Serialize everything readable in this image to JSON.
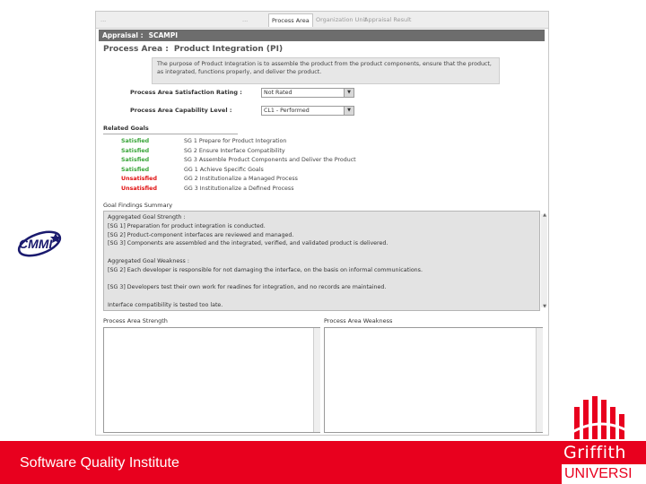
{
  "tabs": [
    {
      "label": "..."
    },
    {
      "label": "..."
    },
    {
      "label": "Process Area"
    },
    {
      "label": "Organization Unit"
    },
    {
      "label": "Appraisal Result"
    }
  ],
  "appraisal": {
    "label": "Appraisal :",
    "value": "SCAMPI"
  },
  "process_area": {
    "label": "Process Area :",
    "value": "Product Integration (PI)",
    "purpose": "The purpose of Product Integration is to assemble the product from the product components, ensure that the product, as integrated, functions properly, and deliver the product."
  },
  "fields": {
    "satisfaction_label": "Process Area Satisfaction Rating :",
    "satisfaction_value": "Not Rated",
    "capability_label": "Process Area Capability Level :",
    "capability_value": "CL1 - Performed"
  },
  "related_goals": {
    "title": "Related Goals",
    "items": [
      {
        "status": "Satisfied",
        "goal": "SG 1 Prepare for Product Integration"
      },
      {
        "status": "Satisfied",
        "goal": "SG 2 Ensure Interface Compatibility"
      },
      {
        "status": "Satisfied",
        "goal": "SG 3 Assemble Product Components and Deliver the Product"
      },
      {
        "status": "Satisfied",
        "goal": "GG 1 Achieve Specific Goals"
      },
      {
        "status": "Unsatisfied",
        "goal": "GG 2 Institutionalize a Managed Process"
      },
      {
        "status": "Unsatisfied",
        "goal": "GG 3 Institutionalize a Defined Process"
      }
    ]
  },
  "findings": {
    "title": "Goal Findings Summary",
    "lines": [
      "Aggregated Goal Strength :",
      "[SG 1]   Preparation for product integration is conducted.",
      "[SG 2]   Product-component interfaces are reviewed and managed.",
      "[SG 3]   Components are assembled and the integrated, verified, and validated product is delivered.",
      "",
      "Aggregated Goal Weakness :",
      "[SG 2]   Each developer is responsible for not damaging the interface, on the basis on informal communications.",
      "",
      "[SG 3]   Developers test their own work for readines for integration, and no records are maintained.",
      "",
      "Interface compatibility is tested too late."
    ]
  },
  "strength_label": "Process Area Strength",
  "weakness_label": "Process Area Weakness",
  "footer": {
    "institute": "Software Quality Institute"
  },
  "griffith": {
    "name": "Griffith",
    "university": "UNIVERSI"
  },
  "cmmi": {
    "label": "CMMI"
  },
  "colors": {
    "satisfied": "#3aa53a",
    "unsatisfied": "#e01010",
    "brand_red": "#e8001e"
  }
}
